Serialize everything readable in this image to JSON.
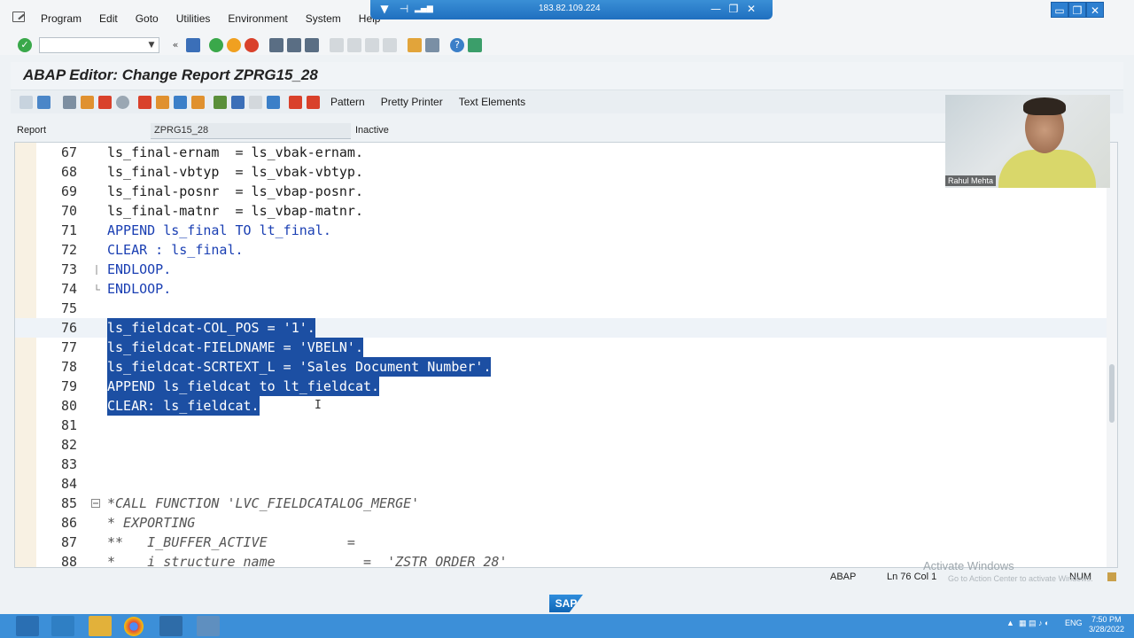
{
  "menu": {
    "items": [
      "Program",
      "Edit",
      "Goto",
      "Utilities",
      "Environment",
      "System",
      "Help"
    ]
  },
  "remote": {
    "ip": "183.82.109.224"
  },
  "toolbar": {
    "command_value": ""
  },
  "title": "ABAP Editor: Change Report ZPRG15_28",
  "app_toolbar": {
    "pattern": "Pattern",
    "pretty_printer": "Pretty Printer",
    "text_elements": "Text Elements"
  },
  "report": {
    "label": "Report",
    "name": "ZPRG15_28",
    "status": "Inactive"
  },
  "editor": {
    "lines": [
      {
        "n": "67",
        "text": "ls_final-ernam  = ls_vbak-ernam."
      },
      {
        "n": "68",
        "text": "ls_final-vbtyp  = ls_vbak-vbtyp."
      },
      {
        "n": "69",
        "text": "ls_final-posnr  = ls_vbap-posnr."
      },
      {
        "n": "70",
        "text": "ls_final-matnr  = ls_vbap-matnr."
      },
      {
        "n": "71",
        "text": "APPEND ls_final TO lt_final."
      },
      {
        "n": "72",
        "text": "CLEAR : ls_final."
      },
      {
        "n": "73",
        "text": "ENDLOOP."
      },
      {
        "n": "74",
        "text": "ENDLOOP."
      },
      {
        "n": "75",
        "text": ""
      },
      {
        "n": "76",
        "text": "ls_fieldcat-COL_POS = '1'."
      },
      {
        "n": "77",
        "text": "ls_fieldcat-FIELDNAME = 'VBELN'."
      },
      {
        "n": "78",
        "text": "ls_fieldcat-SCRTEXT_L = 'Sales Document Number'."
      },
      {
        "n": "79",
        "text": "APPEND ls_fieldcat to lt_fieldcat."
      },
      {
        "n": "80",
        "text": "CLEAR: ls_fieldcat."
      },
      {
        "n": "81",
        "text": ""
      },
      {
        "n": "82",
        "text": ""
      },
      {
        "n": "83",
        "text": ""
      },
      {
        "n": "84",
        "text": ""
      },
      {
        "n": "85",
        "text": "*CALL FUNCTION 'LVC_FIELDCATALOG_MERGE'"
      },
      {
        "n": "86",
        "text": "* EXPORTING"
      },
      {
        "n": "87",
        "text": "**   I_BUFFER_ACTIVE          ="
      },
      {
        "n": "88",
        "text": "*    i_structure_name           =  'ZSTR_ORDER_28'"
      }
    ]
  },
  "webcam": {
    "name": "Rahul Mehta"
  },
  "status": {
    "lang": "ABAP",
    "position": "Ln 76 Col  1",
    "mode": "NUM"
  },
  "watermark": {
    "title": "Activate Windows",
    "sub": "Go to Action Center to activate Windows."
  },
  "clock": {
    "time": "7:50 PM",
    "date": "3/28/2022",
    "lang": "ENG"
  }
}
